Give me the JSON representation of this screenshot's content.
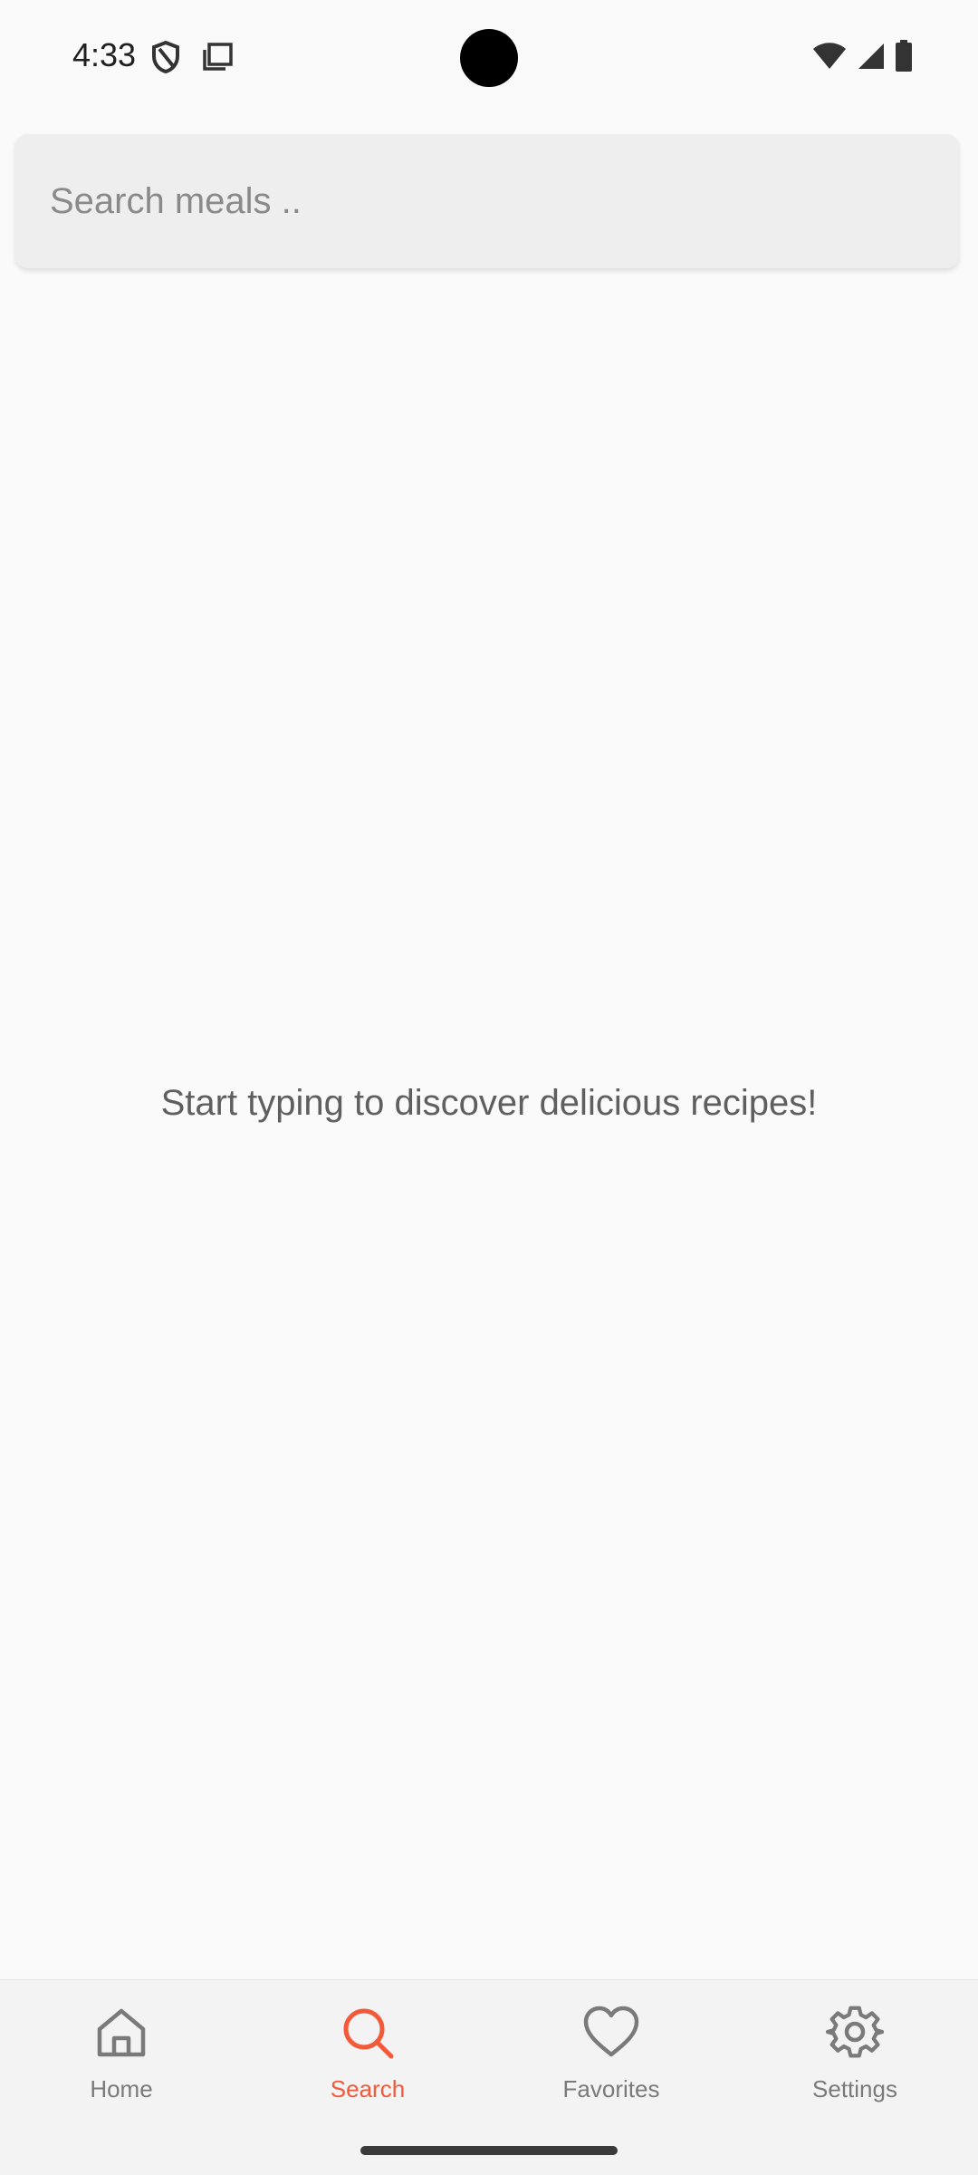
{
  "status_bar": {
    "time": "4:33",
    "left_icons": [
      "shield-icon",
      "screen-copy-icon"
    ],
    "right_icons": [
      "wifi-icon",
      "signal-icon",
      "battery-icon"
    ]
  },
  "search": {
    "placeholder": "Search meals ..",
    "value": ""
  },
  "empty_state": {
    "message": "Start typing to discover delicious recipes!"
  },
  "bottom_nav": {
    "active": "Search",
    "accent_color": "#f25a3a",
    "items": [
      {
        "label": "Home",
        "icon": "home-icon"
      },
      {
        "label": "Search",
        "icon": "search-icon"
      },
      {
        "label": "Favorites",
        "icon": "heart-icon"
      },
      {
        "label": "Settings",
        "icon": "gear-icon"
      }
    ]
  }
}
